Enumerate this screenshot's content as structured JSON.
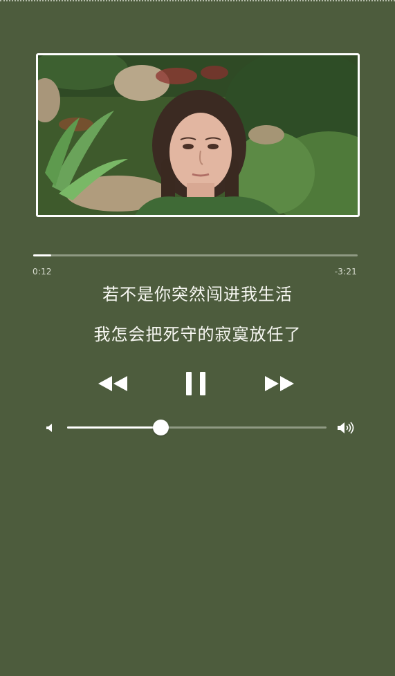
{
  "player": {
    "artwork_icon": "album-artwork-photo",
    "progress_fraction": 0.055,
    "time_elapsed": "0:12",
    "time_remaining": "-3:21",
    "volume_fraction": 0.36
  },
  "lyrics": {
    "line1": "若不是你突然闯进我生活",
    "line2": "我怎会把死守的寂寞放任了"
  },
  "controls": {
    "rewind_icon": "rewind-icon",
    "pause_icon": "pause-icon",
    "forward_icon": "fast-forward-icon",
    "volume_low_icon": "volume-low-icon",
    "volume_high_icon": "volume-high-icon"
  },
  "colors": {
    "background": "#4d5c3d",
    "accent": "#ffffff",
    "track": "#8f9a83"
  }
}
